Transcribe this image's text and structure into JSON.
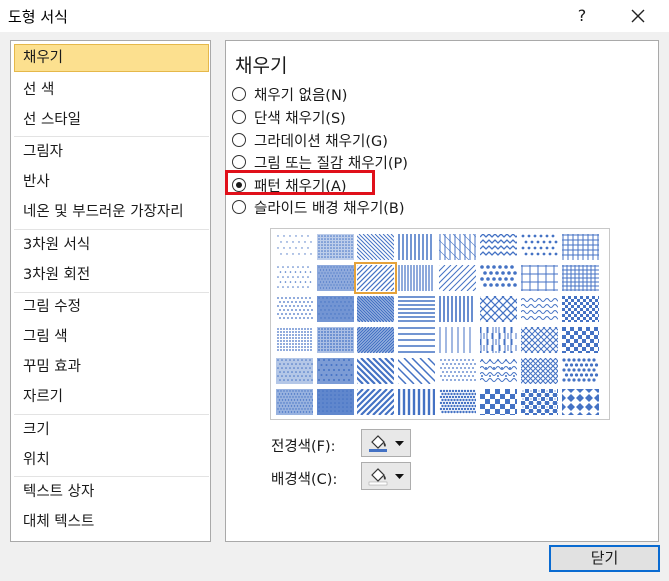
{
  "window": {
    "title": "도형 서식",
    "help_label": "?",
    "close_label": "×"
  },
  "sidebar": {
    "items": [
      {
        "label": "채우기",
        "selected": true
      },
      {
        "label": "선 색"
      },
      {
        "label": "선 스타일"
      },
      {
        "label": "그림자"
      },
      {
        "label": "반사"
      },
      {
        "label": "네온 및 부드러운 가장자리"
      },
      {
        "label": "3차원 서식"
      },
      {
        "label": "3차원 회전"
      },
      {
        "label": "그림 수정"
      },
      {
        "label": "그림 색"
      },
      {
        "label": "꾸밈 효과"
      },
      {
        "label": "자르기"
      },
      {
        "label": "크기"
      },
      {
        "label": "위치"
      },
      {
        "label": "텍스트 상자"
      },
      {
        "label": "대체 텍스트"
      }
    ]
  },
  "panel": {
    "title": "채우기",
    "options": [
      {
        "label": "채우기 없음(N)",
        "checked": false
      },
      {
        "label": "단색 채우기(S)",
        "checked": false
      },
      {
        "label": "그라데이션 채우기(G)",
        "checked": false
      },
      {
        "label": "그림 또는 질감 채우기(P)",
        "checked": false
      },
      {
        "label": "패턴 채우기(A)",
        "checked": true
      },
      {
        "label": "슬라이드 배경 채우기(B)",
        "checked": false
      }
    ],
    "pattern_color": "#4472c4",
    "pattern_grid": {
      "columns": 8,
      "rows": 6,
      "selected_index": 10
    },
    "foreground_label": "전경색(F):",
    "background_label": "배경색(C):"
  },
  "footer": {
    "close_label": "닫기"
  },
  "colors": {
    "selection_fill": "#fce08f",
    "selection_border": "#e5b84a",
    "highlight_box": "#e0101a",
    "default_button_border": "#0a6bd1"
  }
}
